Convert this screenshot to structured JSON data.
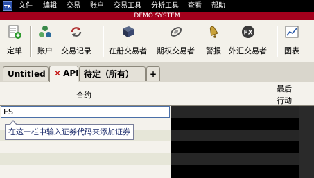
{
  "app_icon": "TB",
  "menu": [
    "文件",
    "编辑",
    "交易",
    "账户",
    "交易工具",
    "分析工具",
    "查看",
    "帮助"
  ],
  "banner": "DEMO SYSTEM",
  "toolbar": [
    {
      "label": "定单",
      "icon": "order-icon"
    },
    {
      "label": "账户",
      "icon": "account-icon"
    },
    {
      "label": "交易记录",
      "icon": "trade-log-icon"
    },
    {
      "label": "在册交易者",
      "icon": "book-trader-icon"
    },
    {
      "label": "期权交易者",
      "icon": "option-trader-icon"
    },
    {
      "label": "警报",
      "icon": "alert-bell-icon"
    },
    {
      "label": "外汇交易者",
      "icon": "fx-trader-icon"
    },
    {
      "label": "图表",
      "icon": "chart-icon"
    }
  ],
  "tabs": [
    {
      "label": "Untitled",
      "active": false
    },
    {
      "label": "API",
      "active": true,
      "close": "✕"
    },
    {
      "label": "待定（所有）",
      "active": false
    },
    {
      "label": "+",
      "active": false
    }
  ],
  "columns": {
    "contract": "合约",
    "last_top": "最后",
    "last_bottom": "行动"
  },
  "symbol_input": {
    "value": "ES"
  },
  "tooltip": "在这一栏中输入证券代码来添加证券"
}
